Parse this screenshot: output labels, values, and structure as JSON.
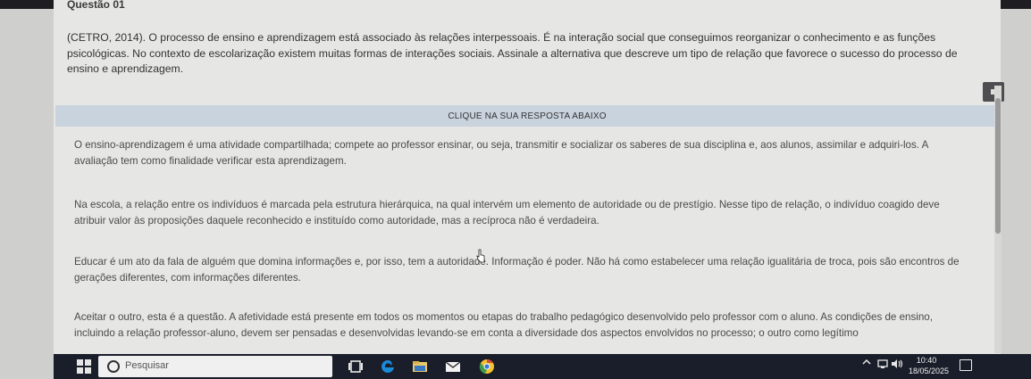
{
  "question": {
    "title": "Questão 01",
    "text": "(CETRO, 2014). O processo de ensino e aprendizagem está associado às relações interpessoais. É na interação social que conseguimos reorganizar o conhecimento e as funções psicológicas. No contexto de escolarização existem muitas formas de interações sociais. Assinale a alternativa que descreve um tipo de relação que favorece o sucesso do processo de ensino e aprendizagem."
  },
  "answers": {
    "banner": "CLIQUE NA SUA RESPOSTA ABAIXO",
    "options": [
      "O ensino-aprendizagem é uma atividade compartilhada; compete ao professor ensinar, ou seja, transmitir e socializar os saberes de sua disciplina e, aos alunos, assimilar e adquiri-los. A avaliação tem como finalidade verificar esta aprendizagem.",
      "Na escola, a relação entre os indivíduos é marcada pela estrutura hierárquica, na qual intervém um elemento de autoridade ou de prestígio. Nesse tipo de relação, o indivíduo coagido deve atribuir valor às proposições daquele reconhecido e instituído como autoridade, mas a recíproca não é verdadeira.",
      "Educar é um ato da fala de alguém que domina informações e, por isso, tem a autoridade. Informação é poder. Não há como estabelecer uma relação igualitária de troca, pois são encontros de gerações diferentes, com informações diferentes.",
      "Aceitar o outro, esta é a questão. A afetividade está presente em todos os momentos ou etapas do trabalho pedagógico desenvolvido pelo professor com o aluno. As condições de ensino, incluindo a relação professor-aluno, devem ser pensadas e desenvolvidas levando-se em conta a diversidade dos aspectos envolvidos no processo; o outro como legítimo"
    ]
  },
  "taskbar": {
    "search_placeholder": "Pesquisar",
    "time": "10:40",
    "date": "18/05/2025",
    "icons": [
      "windows-start-icon",
      "search-icon",
      "microphone-icon",
      "task-view-icon",
      "edge-icon",
      "file-explorer-icon",
      "mail-icon",
      "chrome-icon",
      "chevron-up-icon",
      "network-icon",
      "volume-icon",
      "notification-icon"
    ]
  },
  "colors": {
    "page_bg": "#e6e6e4",
    "banner_bg": "#c9d3de",
    "taskbar_bg": "#1a1e2a",
    "edge_blue": "#1d8ad8",
    "chrome_yellow": "#f2c230"
  }
}
